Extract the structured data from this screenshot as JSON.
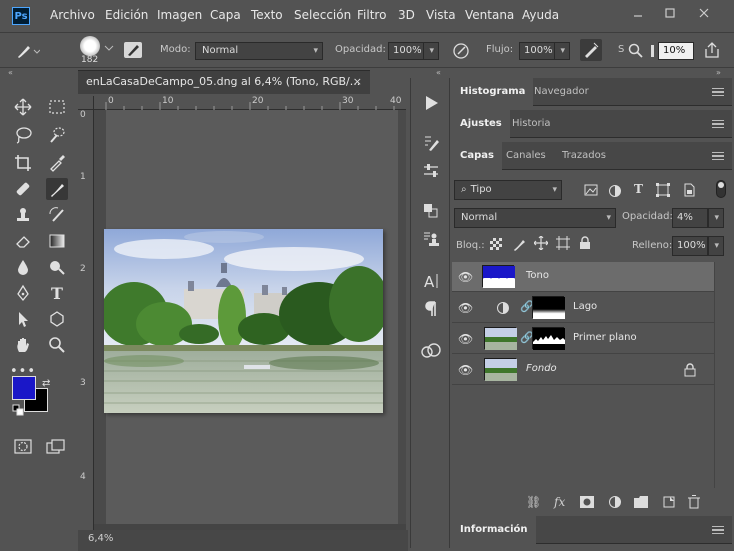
{
  "app": {
    "logo": "Ps"
  },
  "menu": [
    "Archivo",
    "Edición",
    "Imagen",
    "Capa",
    "Texto",
    "Selección",
    "Filtro",
    "3D",
    "Vista",
    "Ventana",
    "Ayuda"
  ],
  "options": {
    "brush_size": "182",
    "mode_label": "Modo:",
    "mode_value": "Normal",
    "opacity_label": "Opacidad:",
    "opacity_value": "100%",
    "flow_label": "Flujo:",
    "flow_value": "100%",
    "smoothing_s": "S",
    "smoothing_value": "10%"
  },
  "document": {
    "tab_title": "enLaCasaDeCampo_05.dng al 6,4% (Tono, RGB/...",
    "close": "×",
    "ruler_h": [
      "0",
      "10",
      "20",
      "30",
      "40"
    ],
    "ruler_v": [
      "0",
      "1",
      "2",
      "3",
      "4"
    ],
    "zoom": "6,4%"
  },
  "panels": {
    "histogram_tab": "Histograma",
    "navigator_tab": "Navegador",
    "adjustments_tab": "Ajustes",
    "history_tab": "Historia",
    "layers_tab": "Capas",
    "channels_tab": "Canales",
    "paths_tab": "Trazados",
    "info_tab": "Información"
  },
  "layers_panel": {
    "filter_kind": "Tipo",
    "blend_mode": "Normal",
    "opacity_label": "Opacidad:",
    "opacity_value": "4%",
    "lock_label": "Bloq.:",
    "fill_label": "Relleno:",
    "fill_value": "100%",
    "layers": [
      {
        "name": "Tono"
      },
      {
        "name": "Lago"
      },
      {
        "name": "Primer plano"
      },
      {
        "name": "Fondo"
      }
    ]
  },
  "colors": {
    "foreground": "#1a17c8",
    "background": "#000000"
  }
}
